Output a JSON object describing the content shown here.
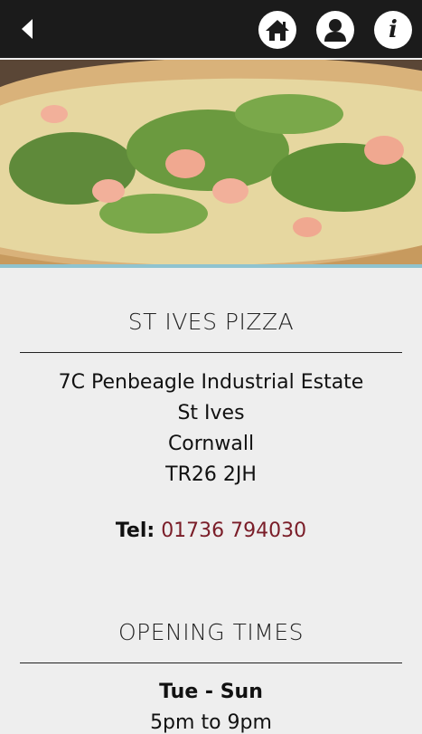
{
  "nav": {
    "back_icon": "back-arrow-icon",
    "home_icon": "home-icon",
    "user_icon": "user-icon",
    "info_icon": "info-icon",
    "info_glyph": "i"
  },
  "hero": {
    "description": "pizza-photo"
  },
  "restaurant": {
    "title": "ST IVES PIZZA",
    "address_line1": "7C Penbeagle Industrial Estate",
    "address_line2": "St Ives",
    "address_line3": "Cornwall",
    "postcode": "TR26 2JH",
    "tel_label": "Tel:",
    "tel_number": "01736 794030"
  },
  "opening": {
    "title": "OPENING TIMES",
    "days": "Tue - Sun",
    "hours": "5pm to 9pm"
  },
  "colors": {
    "topbar": "#1b1b1b",
    "background": "#eeeeee",
    "phone": "#7a1d28",
    "accent_line": "#8fc3cf"
  }
}
